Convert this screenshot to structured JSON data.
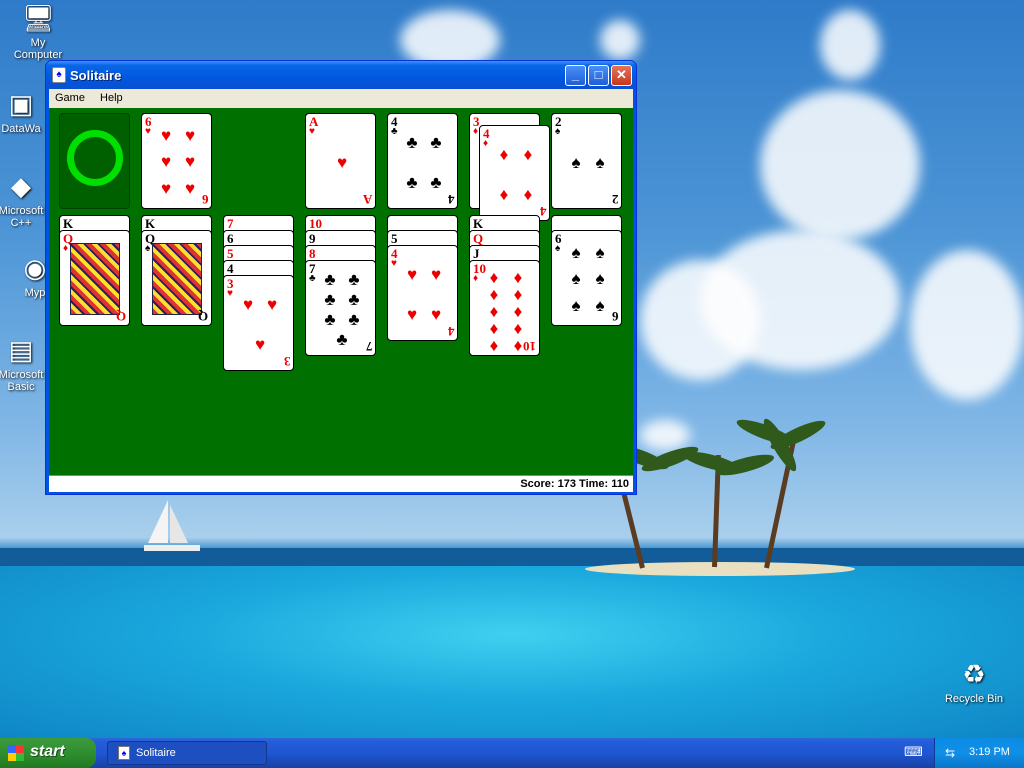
{
  "desktop": {
    "icons": [
      {
        "label": "My Computer",
        "glyph": "computer-icon"
      },
      {
        "label": "DataWa",
        "glyph": "shortcut-icon"
      },
      {
        "label": "Microsoft C++",
        "glyph": "shortcut-icon"
      },
      {
        "label": "Myp",
        "glyph": "shortcut-icon"
      },
      {
        "label": "Microsoft Basic",
        "glyph": "shortcut-icon"
      },
      {
        "label": "Recycle Bin",
        "glyph": "recycle-bin-icon"
      }
    ]
  },
  "window": {
    "title": "Solitaire",
    "menu": [
      "Game",
      "Help"
    ],
    "status": "Score: 173  Time: 110",
    "controls": {
      "minimize": "_",
      "maximize": "□",
      "close": "✕"
    }
  },
  "game": {
    "stock": {
      "state": "empty-recycle",
      "color": "#00e000"
    },
    "waste": {
      "rank": "6",
      "suit": "♥"
    },
    "foundations": [
      {
        "rank": "A",
        "suit": "♥"
      },
      {
        "rank": "4",
        "suit": "♣"
      },
      {
        "rank": "3",
        "suit": "♦",
        "dragging": {
          "rank": "4",
          "suit": "♦"
        }
      },
      {
        "rank": "2",
        "suit": "♠"
      }
    ],
    "tableau": [
      {
        "stack": [
          {
            "rank": "K",
            "suit": "♣"
          },
          {
            "rank": "Q",
            "suit": "♦",
            "face": true
          }
        ]
      },
      {
        "stack": [
          {
            "rank": "K",
            "suit": "♣"
          },
          {
            "rank": "Q",
            "suit": "♠",
            "face": true
          }
        ]
      },
      {
        "stack": [
          {
            "rank": "7",
            "suit": "♥"
          },
          {
            "rank": "6",
            "suit": "♠"
          },
          {
            "rank": "5",
            "suit": "♥"
          },
          {
            "rank": "4",
            "suit": "♠"
          },
          {
            "rank": "3",
            "suit": "♥"
          }
        ]
      },
      {
        "stack": [
          {
            "rank": "10",
            "suit": "♥"
          },
          {
            "rank": "9",
            "suit": "♠"
          },
          {
            "rank": "8",
            "suit": "♥"
          },
          {
            "rank": "7",
            "suit": "♣"
          }
        ]
      },
      {
        "stack": [
          {
            "rank": "",
            "suit": ""
          },
          {
            "rank": "5",
            "suit": "♣"
          },
          {
            "rank": "4",
            "suit": "♥"
          }
        ]
      },
      {
        "stack": [
          {
            "rank": "K",
            "suit": "♣"
          },
          {
            "rank": "Q",
            "suit": "♦"
          },
          {
            "rank": "J",
            "suit": "♠"
          },
          {
            "rank": "10",
            "suit": "♦"
          }
        ]
      },
      {
        "stack": [
          {
            "rank": "",
            "suit": ""
          },
          {
            "rank": "6",
            "suit": "♠"
          }
        ]
      }
    ]
  },
  "taskbar": {
    "start": "start",
    "task": "Solitaire",
    "clock": "3:19 PM",
    "colors": {
      "start": "#2f8f2f",
      "bar": "#245edb"
    }
  }
}
